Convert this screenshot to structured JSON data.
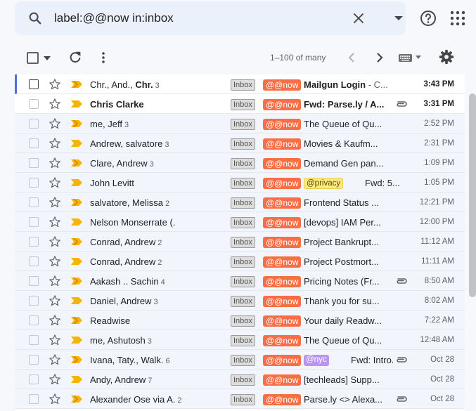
{
  "search": {
    "query": "label:@@now in:inbox"
  },
  "toolbar": {
    "page_range": "1–100 of many"
  },
  "labels": {
    "inbox": "Inbox",
    "now": "@@now"
  },
  "colors": {
    "now_badge": "#fa6e46",
    "important_marker": "#f5b400",
    "privacy_badge": "#ffe980",
    "nyc_badge": "#b995ef",
    "active_row_accent": "#4a74d4"
  },
  "emails": [
    {
      "sender": "Chr., And., ",
      "sender_bold": "Chr.",
      "count": "3",
      "subject": "Mailgun Login",
      "snippet": " - C...",
      "time": "3:43 PM",
      "unread": true,
      "active": true,
      "attachment": false,
      "extra_label": "",
      "extra_style": ""
    },
    {
      "sender": "",
      "sender_bold": "Chris Clarke",
      "count": "",
      "subject": "Fwd: Parse.ly / A...",
      "snippet": "",
      "time": "3:31 PM",
      "unread": true,
      "active": false,
      "attachment": true,
      "extra_label": "",
      "extra_style": ""
    },
    {
      "sender": "me, Jeff",
      "sender_bold": "",
      "count": "3",
      "subject": "The Queue of Qu...",
      "snippet": "",
      "time": "2:52 PM",
      "unread": false,
      "active": false,
      "attachment": false,
      "extra_label": "",
      "extra_style": ""
    },
    {
      "sender": "Andrew, salvatore",
      "sender_bold": "",
      "count": "3",
      "subject": "Movies & Kaufm...",
      "snippet": "",
      "time": "2:31 PM",
      "unread": false,
      "active": false,
      "attachment": false,
      "extra_label": "",
      "extra_style": ""
    },
    {
      "sender": "Clare, Andrew",
      "sender_bold": "",
      "count": "3",
      "subject": "Demand Gen pan...",
      "snippet": "",
      "time": "1:09 PM",
      "unread": false,
      "active": false,
      "attachment": false,
      "extra_label": "",
      "extra_style": ""
    },
    {
      "sender": "John Levitt",
      "sender_bold": "",
      "count": "",
      "subject": "Fwd: 5...",
      "snippet": "",
      "time": "1:05 PM",
      "unread": false,
      "active": false,
      "attachment": false,
      "extra_label": "@privacy",
      "extra_style": "privacy"
    },
    {
      "sender": "salvatore, Melissa",
      "sender_bold": "",
      "count": "2",
      "subject": "Frontend Status ...",
      "snippet": "",
      "time": "12:21 PM",
      "unread": false,
      "active": false,
      "attachment": false,
      "extra_label": "",
      "extra_style": ""
    },
    {
      "sender": "Nelson Monserrate (.",
      "sender_bold": "",
      "count": "",
      "subject": "[devops] IAM Per...",
      "snippet": "",
      "time": "12:00 PM",
      "unread": false,
      "active": false,
      "attachment": false,
      "extra_label": "",
      "extra_style": ""
    },
    {
      "sender": "Conrad, Andrew",
      "sender_bold": "",
      "count": "2",
      "subject": "Project Bankrupt...",
      "snippet": "",
      "time": "11:12 AM",
      "unread": false,
      "active": false,
      "attachment": false,
      "extra_label": "",
      "extra_style": ""
    },
    {
      "sender": "Conrad, Andrew",
      "sender_bold": "",
      "count": "2",
      "subject": "Project Postmort...",
      "snippet": "",
      "time": "11:11 AM",
      "unread": false,
      "active": false,
      "attachment": false,
      "extra_label": "",
      "extra_style": ""
    },
    {
      "sender": "Aakash .. Sachin",
      "sender_bold": "",
      "count": "4",
      "subject": "Pricing Notes (Fr...",
      "snippet": "",
      "time": "8:50 AM",
      "unread": false,
      "active": false,
      "attachment": true,
      "extra_label": "",
      "extra_style": ""
    },
    {
      "sender": "Daniel, Andrew",
      "sender_bold": "",
      "count": "3",
      "subject": "Thank you for su...",
      "snippet": "",
      "time": "8:02 AM",
      "unread": false,
      "active": false,
      "attachment": false,
      "extra_label": "",
      "extra_style": ""
    },
    {
      "sender": "Readwise",
      "sender_bold": "",
      "count": "",
      "subject": "Your daily Readw...",
      "snippet": "",
      "time": "7:22 AM",
      "unread": false,
      "active": false,
      "attachment": false,
      "extra_label": "",
      "extra_style": ""
    },
    {
      "sender": "me, Ashutosh",
      "sender_bold": "",
      "count": "3",
      "subject": "The Queue of Qu...",
      "snippet": "",
      "time": "12:48 AM",
      "unread": false,
      "active": false,
      "attachment": false,
      "extra_label": "",
      "extra_style": ""
    },
    {
      "sender": "Ivana, Taty., Walk.",
      "sender_bold": "",
      "count": "6",
      "subject": "Fwd: Intro...",
      "snippet": "",
      "time": "Oct 28",
      "unread": false,
      "active": false,
      "attachment": true,
      "extra_label": "@nyc",
      "extra_style": "nyc"
    },
    {
      "sender": "Andy, Andrew",
      "sender_bold": "",
      "count": "7",
      "subject": "[techleads] Supp...",
      "snippet": "",
      "time": "Oct 28",
      "unread": false,
      "active": false,
      "attachment": false,
      "extra_label": "",
      "extra_style": ""
    },
    {
      "sender": "Alexander Ose via A.",
      "sender_bold": "",
      "count": "2",
      "subject": "Parse.ly <> Alexa...",
      "snippet": "",
      "time": "Oct 28",
      "unread": false,
      "active": false,
      "attachment": true,
      "extra_label": "",
      "extra_style": ""
    }
  ]
}
